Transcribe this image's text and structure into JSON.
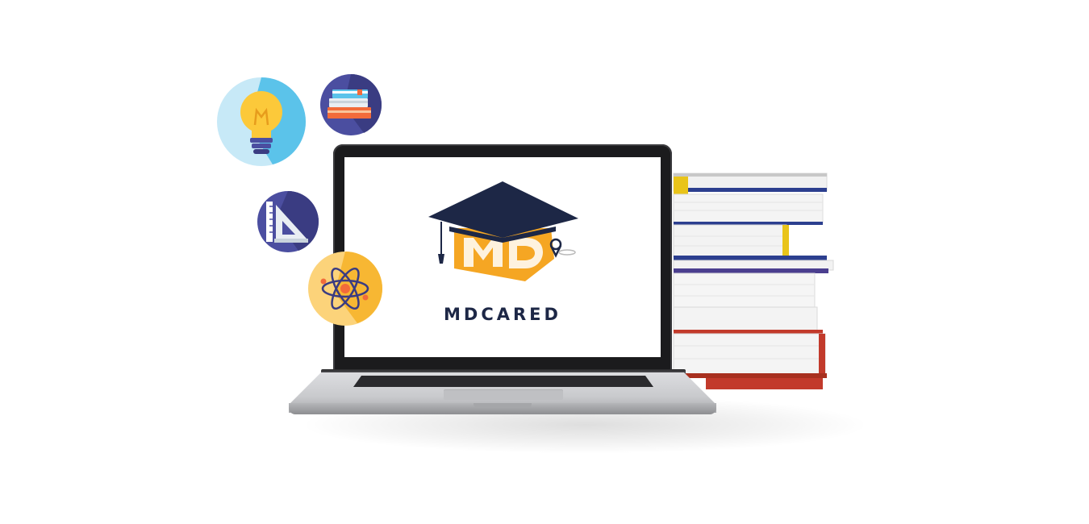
{
  "brand": {
    "name": "MDCARED",
    "logo_letters": "MD"
  },
  "icons": [
    {
      "name": "light-bulb-icon",
      "color": "#5bc3ea"
    },
    {
      "name": "books-icon",
      "color": "#4b4ea0"
    },
    {
      "name": "ruler-triangle-icon",
      "color": "#4b4ea0"
    },
    {
      "name": "atom-icon",
      "color": "#f7b733"
    }
  ],
  "colors": {
    "navy": "#1d2746",
    "orange": "#f5a623",
    "page_edge": "#f3f3f3",
    "book_red": "#c23a2b",
    "book_yellow": "#e9c41a",
    "book_blue": "#2c3f8f"
  }
}
